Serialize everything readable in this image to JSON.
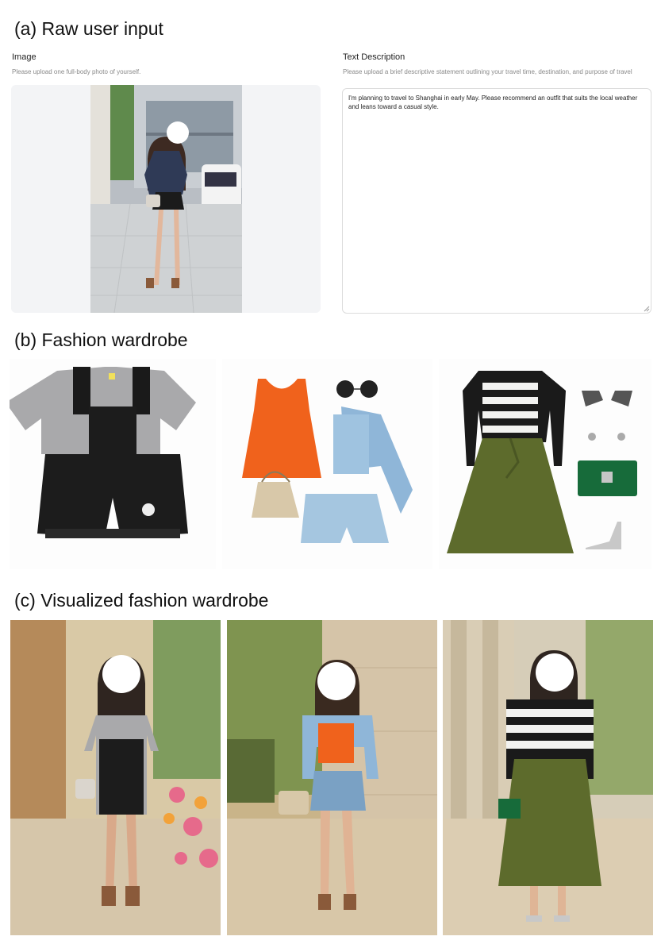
{
  "sections": {
    "a": "(a) Raw user input",
    "b": "(b) Fashion wardrobe",
    "c": "(c) Visualized fashion wardrobe"
  },
  "image_field": {
    "label": "Image",
    "hint": "Please upload one full-body photo of yourself."
  },
  "text_field": {
    "label": "Text Description",
    "hint": "Please upload a brief descriptive statement outlining your travel time, destination, and purpose of travel",
    "value": "I'm planning to travel to Shanghai in early May. Please recommend an outfit that suits the local weather and leans toward a casual style."
  },
  "colors": {
    "orange_tank": "#f0621c",
    "denim": "#8fb6d8",
    "olive": "#5d6b2c",
    "black": "#1a1a1a",
    "grey_tee": "#a9a9ab",
    "green_bag": "#176b3a"
  }
}
